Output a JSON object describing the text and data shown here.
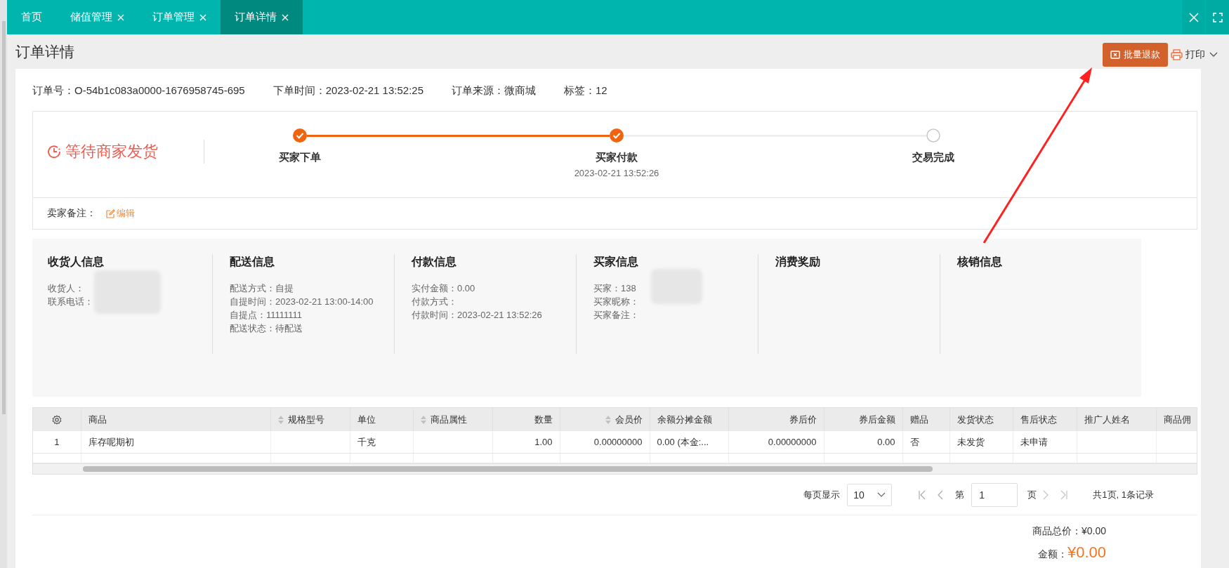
{
  "tabs": [
    {
      "label": "首页",
      "closable": false,
      "selected": false
    },
    {
      "label": "储值管理",
      "closable": true,
      "selected": false
    },
    {
      "label": "订单管理",
      "closable": true,
      "selected": false
    },
    {
      "label": "订单详情",
      "closable": true,
      "selected": true
    }
  ],
  "page_title": "订单详情",
  "actions": {
    "refund_button": "批量退款",
    "print_button": "打印"
  },
  "order_info": [
    {
      "label": "订单号：",
      "value": "O-54b1c083a0000-1676958745-695"
    },
    {
      "label": "下单时间：",
      "value": "2023-02-21 13:52:25"
    },
    {
      "label": "订单来源：",
      "value": "微商城"
    },
    {
      "label": "标签：",
      "value": "12"
    }
  ],
  "status": {
    "text": "等待商家发货",
    "steps": [
      {
        "label": "买家下单",
        "done": true
      },
      {
        "label": "买家付款",
        "time": "2023-02-21 13:52:26",
        "done": true
      },
      {
        "label": "交易完成",
        "done": false
      }
    ],
    "seller_note": {
      "label": "卖家备注：",
      "edit": "编辑"
    }
  },
  "info_sections": [
    {
      "title": "收货人信息",
      "masked": true,
      "fields": [
        {
          "label": "收货人："
        },
        {
          "label": "联系电话："
        }
      ]
    },
    {
      "title": "配送信息",
      "masked": false,
      "fields": [
        {
          "label": "配送方式：",
          "value": "自提"
        },
        {
          "label": "自提时间：",
          "value": "2023-02-21 13:00-14:00"
        },
        {
          "label": "自提点：",
          "value": "11111111"
        },
        {
          "label": "配送状态：",
          "value": "待配送"
        }
      ]
    },
    {
      "title": "付款信息",
      "masked": false,
      "fields": [
        {
          "label": "实付金额：",
          "value": "0.00"
        },
        {
          "label": "付款方式："
        },
        {
          "label": "付款时间：",
          "value": "2023-02-21 13:52:26"
        }
      ]
    },
    {
      "title": "买家信息",
      "masked": true,
      "fields": [
        {
          "label": "买家：",
          "value": "138"
        },
        {
          "label": "买家昵称："
        },
        {
          "label": "买家备注："
        }
      ]
    },
    {
      "title": "消费奖励",
      "masked": false
    },
    {
      "title": "核销信息",
      "masked": false
    }
  ],
  "table": {
    "columns": [
      {
        "kind": "settings"
      },
      {
        "label": "商品",
        "kind": "text",
        "sortable": false
      },
      {
        "label": "规格型号",
        "kind": "text",
        "sortable": true
      },
      {
        "label": "单位",
        "kind": "text",
        "sortable": false
      },
      {
        "label": "商品属性",
        "kind": "text",
        "sortable": true
      },
      {
        "label": "数量",
        "kind": "number",
        "sortable": false
      },
      {
        "label": "会员价",
        "kind": "number",
        "sortable": true
      },
      {
        "label": "余额分摊金额",
        "kind": "text",
        "sortable": false
      },
      {
        "label": "券后价",
        "kind": "number",
        "sortable": false
      },
      {
        "label": "券后金额",
        "kind": "number",
        "sortable": false
      },
      {
        "label": "赠品",
        "kind": "text",
        "sortable": false
      },
      {
        "label": "发货状态",
        "kind": "text",
        "sortable": false
      },
      {
        "label": "售后状态",
        "kind": "text",
        "sortable": false
      },
      {
        "label": "推广人姓名",
        "kind": "text",
        "sortable": false
      },
      {
        "label": "商品佣",
        "kind": "text",
        "sortable": false
      }
    ],
    "rows": [
      {
        "cells": [
          "1",
          "库存呢期初",
          null,
          "千克",
          null,
          "1.00",
          "0.00000000",
          "0.00 (本金:...",
          "0.00000000",
          "0.00",
          "否",
          "未发货",
          "未申请",
          null,
          null
        ]
      }
    ]
  },
  "pager": {
    "page_size_label": "每页显示",
    "page_size": "10",
    "page_prefix": "第",
    "page": "1",
    "page_suffix": "页",
    "summary": "共1页, 1条记录"
  },
  "totals": [
    {
      "label": "商品总价：",
      "value": "¥0.00",
      "kind": "subtotal"
    },
    {
      "label": "金额：",
      "value": "¥0.00",
      "kind": "total"
    }
  ]
}
